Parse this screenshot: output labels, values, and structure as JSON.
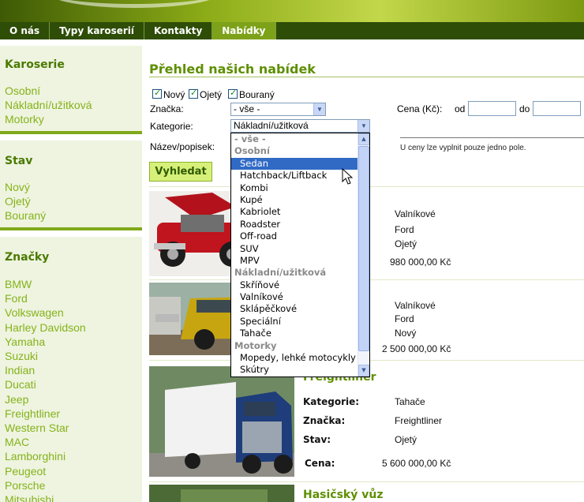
{
  "nav": {
    "items": [
      {
        "label": "O nás",
        "active": false
      },
      {
        "label": "Typy karoserií",
        "active": false
      },
      {
        "label": "Kontakty",
        "active": false
      },
      {
        "label": "Nabídky",
        "active": true
      }
    ]
  },
  "sidebar": {
    "karoserie": {
      "title": "Karoserie",
      "items": [
        "Osobní",
        "Nákladní/užitková",
        "Motorky"
      ]
    },
    "stav": {
      "title": "Stav",
      "items": [
        "Nový",
        "Ojetý",
        "Bouraný"
      ]
    },
    "znacky": {
      "title": "Značky",
      "items": [
        "BMW",
        "Ford",
        "Volkswagen",
        "Harley Davidson",
        "Yamaha",
        "Suzuki",
        "Indian",
        "Ducati",
        "Jeep",
        "Freightliner",
        "Western Star",
        "MAC",
        "Lamborghini",
        "Peugeot",
        "Porsche",
        "Mitsubishi"
      ]
    }
  },
  "main": {
    "title": "Přehled našich nabídek",
    "filters": {
      "novy": "Nový",
      "ojety": "Ojetý",
      "bourany": "Bouraný",
      "znacka_label": "Značka:",
      "znacka_value": "- vše -",
      "kategorie_label": "Kategorie:",
      "kategorie_value": "Nákladní/užitková",
      "nazev_label": "Název/popisek:",
      "cena_label": "Cena (Kč):",
      "od_label": "od",
      "do_label": "do",
      "hint": "U ceny lze vyplnit pouze jedno pole.",
      "search_button": "Vyhledat"
    }
  },
  "dropdown": {
    "options": [
      {
        "label": "- vše -",
        "kind": "all"
      },
      {
        "label": "Osobní",
        "kind": "group"
      },
      {
        "label": "Sedan",
        "kind": "option",
        "selected": true
      },
      {
        "label": "Hatchback/Liftback",
        "kind": "option"
      },
      {
        "label": "Kombi",
        "kind": "option"
      },
      {
        "label": "Kupé",
        "kind": "option"
      },
      {
        "label": "Kabriolet",
        "kind": "option"
      },
      {
        "label": "Roadster",
        "kind": "option"
      },
      {
        "label": "Off-road",
        "kind": "option"
      },
      {
        "label": "SUV",
        "kind": "option"
      },
      {
        "label": "MPV",
        "kind": "option"
      },
      {
        "label": "Nákladní/užitková",
        "kind": "group"
      },
      {
        "label": "Skříňové",
        "kind": "option"
      },
      {
        "label": "Valníkové",
        "kind": "option"
      },
      {
        "label": "Sklápěčkové",
        "kind": "option"
      },
      {
        "label": "Speciální",
        "kind": "option"
      },
      {
        "label": "Tahače",
        "kind": "option"
      },
      {
        "label": "Motorky",
        "kind": "group"
      },
      {
        "label": "Mopedy, lehké motocykly",
        "kind": "option"
      },
      {
        "label": "Skútry",
        "kind": "option"
      }
    ]
  },
  "listings": [
    {
      "kategorie": "Valníkové",
      "znacka": "Ford",
      "stav": "Ojetý",
      "cena": "980 000,00 Kč"
    },
    {
      "kategorie": "Valníkové",
      "znacka": "Ford",
      "stav": "Nový",
      "cena": "2 500 000,00 Kč"
    },
    {
      "title": "Freightliner",
      "kategorie_label": "Kategorie:",
      "kategorie": "Tahače",
      "znacka_label": "Značka:",
      "znacka": "Freightliner",
      "stav_label": "Stav:",
      "stav": "Ojetý",
      "cena_label": "Cena:",
      "cena": "5 600 000,00 Kč"
    },
    {
      "title": "Hasičský vůz"
    }
  ]
}
